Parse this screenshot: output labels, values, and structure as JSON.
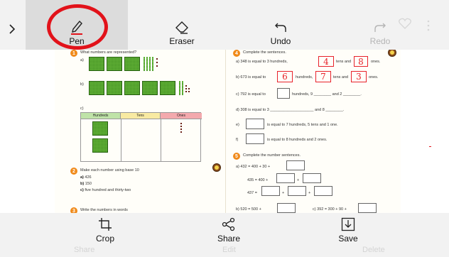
{
  "toolbar": {
    "pen_label": "Pen",
    "eraser_label": "Eraser",
    "undo_label": "Undo",
    "redo_label": "Redo",
    "accent_color": "#e2121a"
  },
  "worksheet": {
    "left": {
      "q1_num": "1",
      "q1_title": "What numbers are represented?",
      "q1_a": "a)",
      "q1_b": "b)",
      "q1_c": "c)",
      "col_hundreds": "Hundreds",
      "col_tens": "Tens",
      "col_ones": "Ones",
      "q2_num": "2",
      "q2_title": "Make each number using base 10",
      "q2_a": "426",
      "q2_b": "150",
      "q2_c": "five hundred and thirty-two",
      "q3_num": "3",
      "q3_partial": "Write the numbers in words"
    },
    "right": {
      "q4_num": "4",
      "q4_title": "Complete the sentences.",
      "a_pre": "a)  348 is equal to 3 hundreds,",
      "a_mid": "tens and",
      "a_end": "ones.",
      "a_ink1": "4",
      "a_ink2": "8",
      "b_pre": "b)  673 is equal to",
      "b_mid1": "hundreds,",
      "b_mid2": "tens and",
      "b_end": "ones.",
      "b_ink1": "6",
      "b_ink2": "7",
      "b_ink3": "3",
      "c_pre": "c)  792 is equal to",
      "c_mid": "hundreds, 9 ________ and 2 ________.",
      "d_line": "d)  308 is equal to 3 ____________________ and 8 ________.",
      "e_pre": "e)",
      "e_text": "is equal to 7 hundreds, 5 tens and 1 one.",
      "f_pre": "f)",
      "f_text": "is equal to 8 hundreds and 2 ones.",
      "q5_num": "5",
      "q5_title": "Complete the number sentences.",
      "q5_a": "a)  432 = 400 + 30 +",
      "q5_a2": "435 = 400 +",
      "q5_a3": "437 =",
      "plus": "+",
      "q5_b": "b)  520 = 500 +",
      "q5_c": "c)  392 = 300 + 90 +"
    }
  },
  "bottom": {
    "crop_label": "Crop",
    "share_label": "Share",
    "save_label": "Save",
    "ghost_share": "Share",
    "ghost_edit": "Edit",
    "ghost_delete": "Delete"
  }
}
